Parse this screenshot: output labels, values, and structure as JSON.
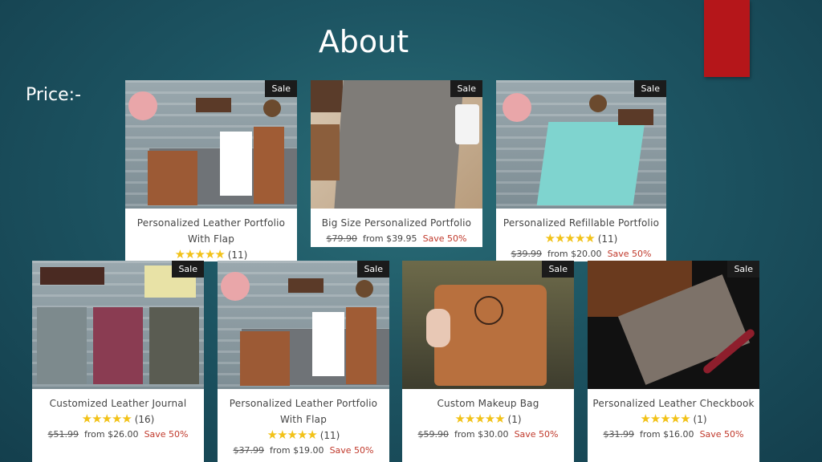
{
  "slide": {
    "title": "About",
    "price_label": "Price:-"
  },
  "colors": {
    "accent": "#b5161a",
    "sale_text": "#c0392b",
    "star": "#f2c218"
  },
  "products": [
    {
      "name": "Personalized Leather Portfolio With Flap",
      "badge": "Sale",
      "stars": "★★★★★",
      "reviews": "(11)",
      "old_price": "",
      "from_price": "",
      "save": ""
    },
    {
      "name": "Big Size Personalized Portfolio",
      "badge": "Sale",
      "stars": "",
      "reviews": "",
      "old_price": "$79.90",
      "from_price": "from $39.95",
      "save": "Save 50%"
    },
    {
      "name": "Personalized Refillable Portfolio",
      "badge": "Sale",
      "stars": "★★★★★",
      "reviews": "(11)",
      "old_price": "$39.99",
      "from_price": "from $20.00",
      "save": "Save 50%"
    },
    {
      "name": "Customized Leather Journal",
      "badge": "Sale",
      "stars": "★★★★★",
      "reviews": "(16)",
      "old_price": "$51.99",
      "from_price": "from $26.00",
      "save": "Save 50%"
    },
    {
      "name": "Personalized Leather Portfolio With Flap",
      "badge": "Sale",
      "stars": "★★★★★",
      "reviews": "(11)",
      "old_price": "$37.99",
      "from_price": "from $19.00",
      "save": "Save 50%"
    },
    {
      "name": "Custom Makeup Bag",
      "badge": "Sale",
      "stars": "★★★★★",
      "reviews": "(1)",
      "old_price": "$59.90",
      "from_price": "from $30.00",
      "save": "Save 50%"
    },
    {
      "name": "Personalized Leather Checkbook",
      "badge": "Sale",
      "stars": "★★★★★",
      "reviews": "(1)",
      "old_price": "$31.99",
      "from_price": "from $16.00",
      "save": "Save 50%"
    }
  ]
}
